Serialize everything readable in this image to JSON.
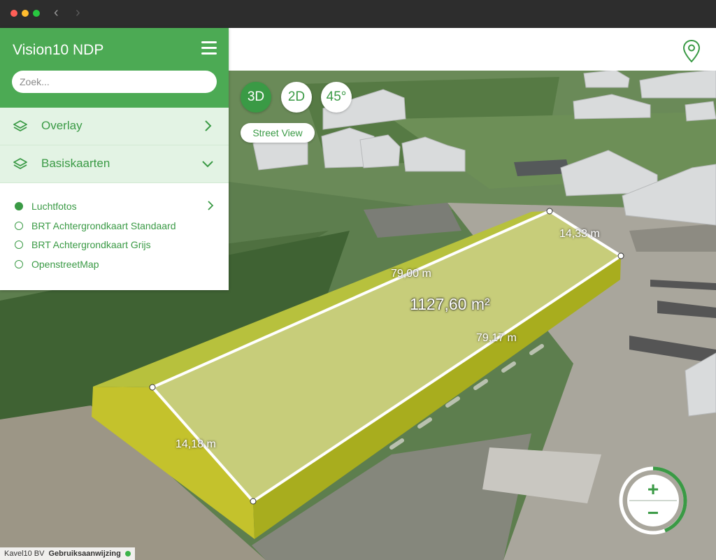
{
  "app": {
    "title": "Vision10 NDP",
    "accent": "#4caa54"
  },
  "search": {
    "placeholder": "Zoek...",
    "value": ""
  },
  "menu": {
    "overlay_label": "Overlay",
    "basiskaarten_label": "Basiskaarten",
    "basemaps": [
      {
        "label": "Luchtfotos",
        "selected": true
      },
      {
        "label": "BRT Achtergrondkaart Standaard",
        "selected": false
      },
      {
        "label": "BRT Achtergrondkaart Grijs",
        "selected": false
      },
      {
        "label": "OpenstreetMap",
        "selected": false
      }
    ]
  },
  "view_modes": {
    "mode_3d": "3D",
    "mode_2d": "2D",
    "mode_45": "45°",
    "active": "3D"
  },
  "street_view_label": "Street View",
  "measurement": {
    "area": "1127,60 m²",
    "edges": [
      "79,00 m",
      "14,33 m",
      "79,17 m",
      "14,18 m"
    ]
  },
  "zoom": {
    "plus": "+",
    "minus": "−"
  },
  "footer": {
    "company": "Kavel10 BV",
    "manual_link": "Gebruiksaanwijzing"
  },
  "icons": [
    "hamburger-icon",
    "layers-icon",
    "chevron-right-icon",
    "chevron-down-icon",
    "location-pin-icon",
    "back-arrow-icon",
    "forward-arrow-icon"
  ]
}
